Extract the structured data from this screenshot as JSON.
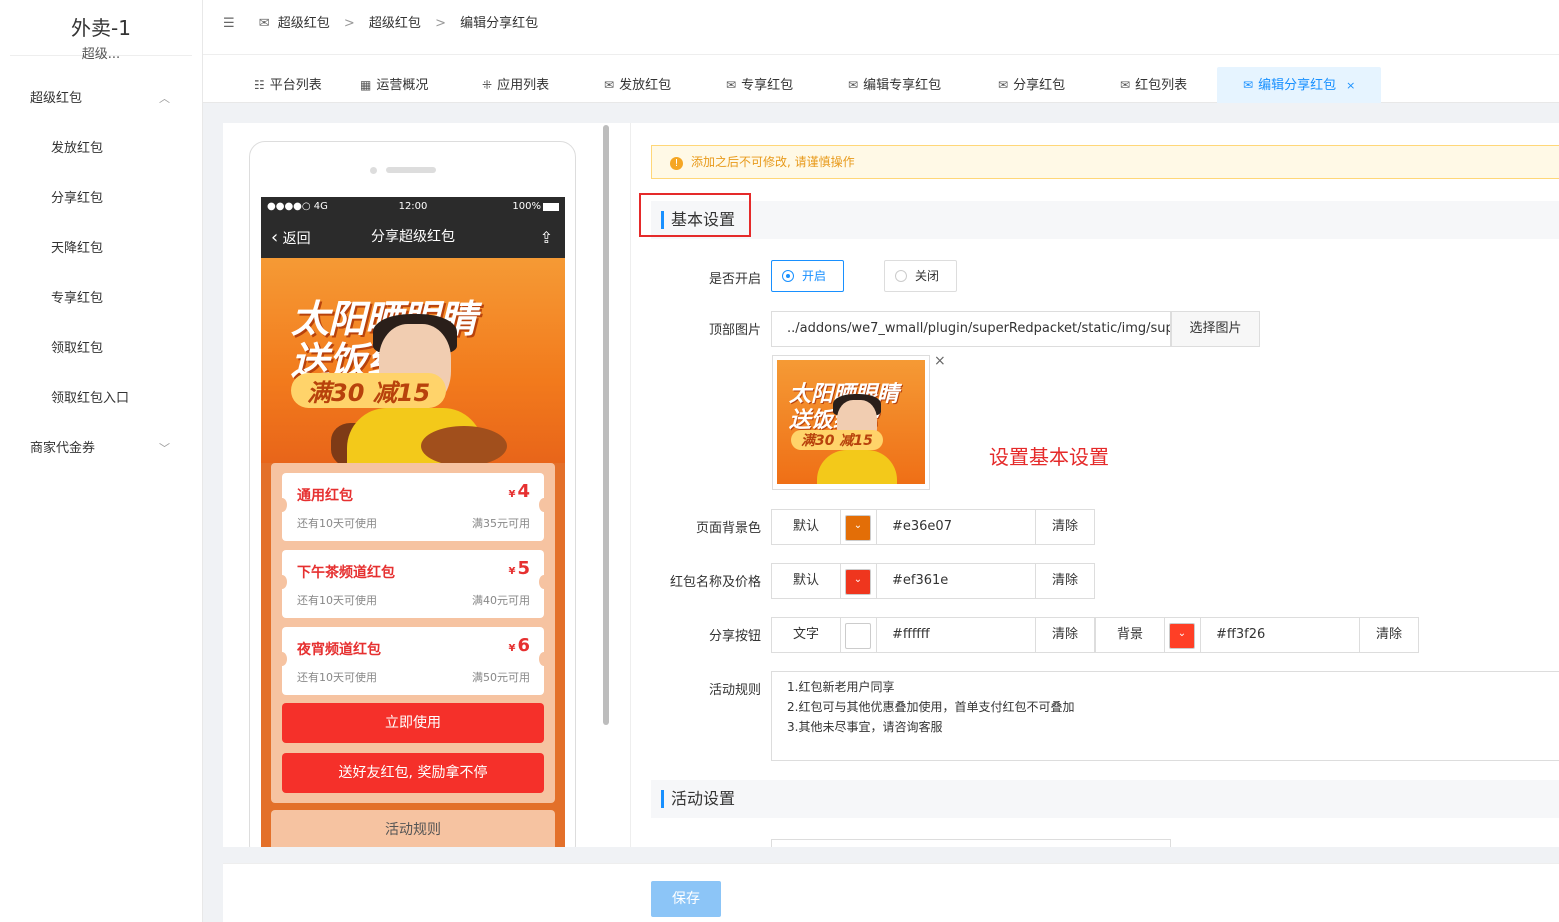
{
  "sidebar": {
    "title": "外卖-1",
    "subtitle": "超级...",
    "groups": [
      {
        "label": "超级红包",
        "chevron": "chevron-up-icon"
      },
      {
        "label": "商家代金券",
        "chevron": "chevron-down-icon"
      }
    ],
    "items": [
      "发放红包",
      "分享红包",
      "天降红包",
      "专享红包",
      "领取红包",
      "领取红包入口"
    ]
  },
  "breadcrumb": {
    "toggle_icon": "collapse-icon",
    "items": [
      "超级红包",
      "超级红包",
      "编辑分享红包"
    ],
    "separator": ">"
  },
  "tabs": [
    {
      "label": "平台列表",
      "icon": "list-icon"
    },
    {
      "label": "运营概况",
      "icon": "grid-icon"
    },
    {
      "label": "应用列表",
      "icon": "apps-icon"
    },
    {
      "label": "发放红包",
      "icon": "envelope-icon"
    },
    {
      "label": "专享红包",
      "icon": "envelope-icon"
    },
    {
      "label": "编辑专享红包",
      "icon": "envelope-icon"
    },
    {
      "label": "分享红包",
      "icon": "envelope-icon"
    },
    {
      "label": "红包列表",
      "icon": "envelope-icon"
    },
    {
      "label": "编辑分享红包",
      "icon": "envelope-icon",
      "active": true,
      "close": "×"
    }
  ],
  "phone": {
    "status_left": "●●●●○ 4G",
    "status_time": "12:00",
    "status_right": "100%",
    "back_label": "返回",
    "title": "分享超级红包",
    "banner_line1": "太阳晒眼睛",
    "banner_line2": "送饭给你",
    "banner_line3": "满30 减15",
    "coupons": [
      {
        "name": "通用红包",
        "currency": "¥",
        "amount": "4",
        "validity": "还有10天可使用",
        "condition": "满35元可用"
      },
      {
        "name": "下午茶频道红包",
        "currency": "¥",
        "amount": "5",
        "validity": "还有10天可使用",
        "condition": "满40元可用"
      },
      {
        "name": "夜宵频道红包",
        "currency": "¥",
        "amount": "6",
        "validity": "还有10天可使用",
        "condition": "满50元可用"
      }
    ],
    "use_button": "立即使用",
    "share_button": "送好友红包, 奖励拿不停",
    "rules_button": "活动规则"
  },
  "form": {
    "alert": "添加之后不可修改, 请谨慎操作",
    "section_basic": "基本设置",
    "section_activity": "活动设置",
    "annotation": "设置基本设置",
    "enable": {
      "label": "是否开启",
      "on": "开启",
      "off": "关闭",
      "selected": "开启"
    },
    "top_image": {
      "label": "顶部图片",
      "value": "../addons/we7_wmall/plugin/superRedpacket/static/img/superRedpacket_share_top.png",
      "button": "选择图片",
      "remove": "×"
    },
    "page_bg": {
      "label": "页面背景色",
      "default": "默认",
      "color": "#e36e07",
      "hex": "#e36e07",
      "clear": "清除"
    },
    "name_price": {
      "label": "红包名称及价格",
      "default": "默认",
      "color": "#ef361e",
      "hex": "#ef361e",
      "clear": "清除"
    },
    "share_btn": {
      "label": "分享按钮",
      "text_label": "文字",
      "text_color": "#ffffff",
      "text_hex": "#ffffff",
      "text_clear": "清除",
      "bg_label": "背景",
      "bg_color": "#ff3f26",
      "bg_hex": "#ff3f26",
      "bg_clear": "清除"
    },
    "rules": {
      "label": "活动规则",
      "lines": [
        "1.红包新老用户同享",
        "2.红包可与其他优惠叠加使用，首单支付红包不可叠加",
        "3.其他未尽事宜，请咨询客服"
      ]
    },
    "save": "保存"
  }
}
